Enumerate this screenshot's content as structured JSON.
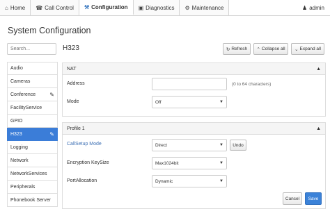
{
  "nav": {
    "tabs": [
      {
        "label": "Home",
        "icon": "home-icon"
      },
      {
        "label": "Call Control",
        "icon": "phone-icon"
      },
      {
        "label": "Configuration",
        "icon": "wrench-icon"
      },
      {
        "label": "Diagnostics",
        "icon": "camera-icon"
      },
      {
        "label": "Maintenance",
        "icon": "gear-icon"
      }
    ],
    "active_tab": "Configuration",
    "user": "admin"
  },
  "page_title": "System Configuration",
  "sidebar": {
    "search_placeholder": "Search...",
    "items": [
      {
        "label": "Audio",
        "active": false,
        "edited": false
      },
      {
        "label": "Cameras",
        "active": false,
        "edited": false
      },
      {
        "label": "Conference",
        "active": false,
        "edited": true
      },
      {
        "label": "FacilityService",
        "active": false,
        "edited": false
      },
      {
        "label": "GPIO",
        "active": false,
        "edited": false
      },
      {
        "label": "H323",
        "active": true,
        "edited": true
      },
      {
        "label": "Logging",
        "active": false,
        "edited": false
      },
      {
        "label": "Network",
        "active": false,
        "edited": false
      },
      {
        "label": "NetworkServices",
        "active": false,
        "edited": false
      },
      {
        "label": "Peripherals",
        "active": false,
        "edited": false
      },
      {
        "label": "Phonebook Server",
        "active": false,
        "edited": false
      }
    ]
  },
  "main": {
    "title": "H323",
    "buttons": {
      "refresh": "Refresh",
      "collapse": "Collapse all",
      "expand": "Expand all"
    },
    "nat": {
      "heading": "NAT",
      "address_label": "Address",
      "address_value": "",
      "address_hint": "(0 to 64 characters)",
      "mode_label": "Mode",
      "mode_value": "Off"
    },
    "profile": {
      "heading": "Profile 1",
      "callsetup_label": "CallSetup Mode",
      "callsetup_value": "Direct",
      "undo_label": "Undo",
      "encryption_label": "Encryption KeySize",
      "encryption_value": "Max1024bit",
      "port_label": "PortAllocation",
      "port_value": "Dynamic",
      "cancel_label": "Cancel",
      "save_label": "Save"
    }
  },
  "colors": {
    "accent": "#3b7dd8",
    "link": "#3c6fb4"
  }
}
